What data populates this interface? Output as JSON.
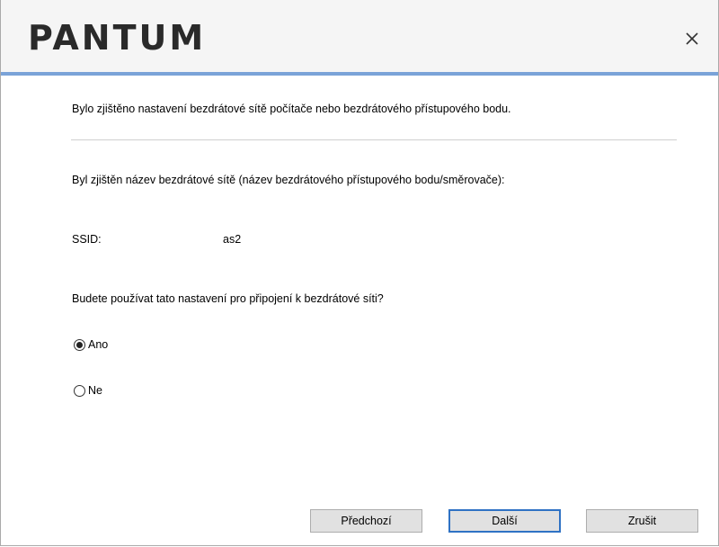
{
  "header": {
    "logo_text": "PANTUM",
    "close_glyph": "×"
  },
  "content": {
    "intro_text": "Bylo zjištěno nastavení bezdrátové sítě počítače nebo bezdrátového přístupového bodu.",
    "detected_label": "Byl zjištěn název bezdrátové sítě (název bezdrátového přístupového bodu/směrovače):",
    "ssid_label": "SSID:",
    "ssid_value": "as2",
    "question": "Budete používat tato nastavení pro připojení k bezdrátové síti?",
    "options": [
      {
        "label": "Ano",
        "selected": true
      },
      {
        "label": "Ne",
        "selected": false
      }
    ]
  },
  "footer": {
    "back_label": "Předchozí",
    "next_label": "Další",
    "cancel_label": "Zrušit"
  },
  "colors": {
    "accent_bar": "#7aa3d8",
    "logo": "#2a2a2a",
    "primary_border": "#2f72c4"
  }
}
